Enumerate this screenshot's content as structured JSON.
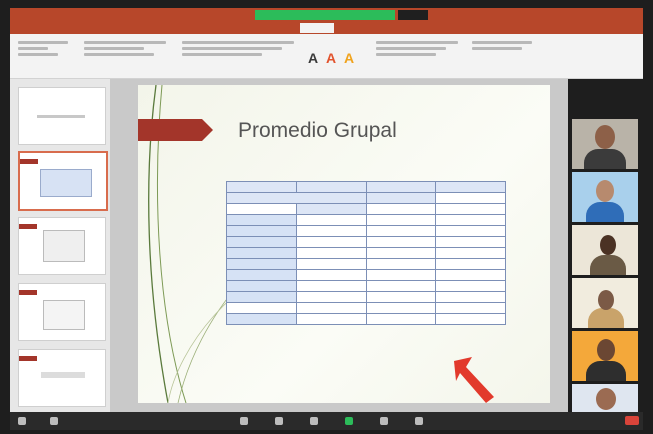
{
  "slide": {
    "title": "Promedio Grupal",
    "table": {
      "rows": [
        [
          "",
          "",
          "",
          ""
        ],
        [
          "",
          "",
          "",
          ""
        ],
        [
          "",
          "",
          "",
          ""
        ],
        [
          "",
          "",
          "",
          ""
        ],
        [
          "",
          "",
          "",
          ""
        ],
        [
          "",
          "",
          "",
          ""
        ],
        [
          "",
          "",
          "",
          ""
        ],
        [
          "",
          "",
          "",
          ""
        ],
        [
          "",
          "",
          "",
          ""
        ],
        [
          "",
          "",
          "",
          ""
        ],
        [
          "",
          "",
          "",
          ""
        ],
        [
          "",
          "",
          "",
          ""
        ],
        [
          "",
          "",
          "",
          ""
        ]
      ]
    }
  },
  "colors": {
    "ppt_brand": "#b7472a",
    "zoom_share": "#2cbc5a",
    "slide_accent": "#a3352a",
    "annotation_arrow": "#e23a2c"
  }
}
